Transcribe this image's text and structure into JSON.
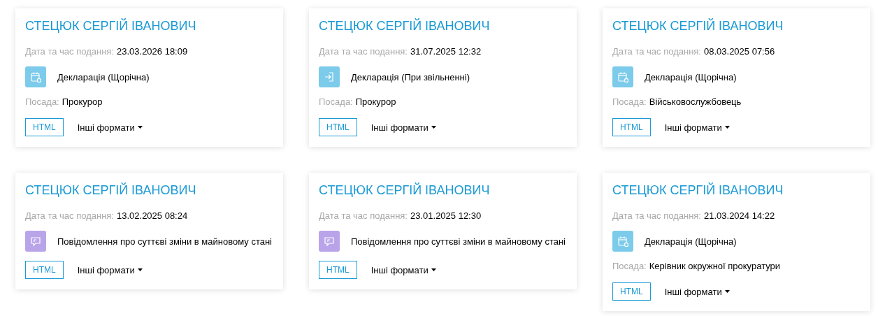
{
  "cards": [
    {
      "name": "СТЕЦЮК СЕРГІЙ ІВАНОВИЧ",
      "date_label": "Дата та час подання:",
      "date": "23.03.2026 18:09",
      "kind": "annual",
      "doc_type": "Декларація (Щорічна)",
      "position_label": "Посада:",
      "position": "Прокурор",
      "html_button": "HTML",
      "formats_button": "Інші формати"
    },
    {
      "name": "СТЕЦЮК СЕРГІЙ ІВАНОВИЧ",
      "date_label": "Дата та час подання:",
      "date": "31.07.2025 12:32",
      "kind": "dismissal",
      "doc_type": "Декларація (При звільненні)",
      "position_label": "Посада:",
      "position": "Прокурор",
      "html_button": "HTML",
      "formats_button": "Інші формати"
    },
    {
      "name": "СТЕЦЮК СЕРГІЙ ІВАНОВИЧ",
      "date_label": "Дата та час подання:",
      "date": "08.03.2025 07:56",
      "kind": "annual",
      "doc_type": "Декларація (Щорічна)",
      "position_label": "Посада:",
      "position": "Військовослужбовець",
      "html_button": "HTML",
      "formats_button": "Інші формати"
    },
    {
      "name": "СТЕЦЮК СЕРГІЙ ІВАНОВИЧ",
      "date_label": "Дата та час подання:",
      "date": "13.02.2025 08:24",
      "kind": "change",
      "doc_type": "Повідомлення про суттєві зміни в майновому стані",
      "html_button": "HTML",
      "formats_button": "Інші формати"
    },
    {
      "name": "СТЕЦЮК СЕРГІЙ ІВАНОВИЧ",
      "date_label": "Дата та час подання:",
      "date": "23.01.2025 12:30",
      "kind": "change",
      "doc_type": "Повідомлення про суттєві зміни в майновому стані",
      "html_button": "HTML",
      "formats_button": "Інші формати"
    },
    {
      "name": "СТЕЦЮК СЕРГІЙ ІВАНОВИЧ",
      "date_label": "Дата та час подання:",
      "date": "21.03.2024 14:22",
      "kind": "annual",
      "doc_type": "Декларація (Щорічна)",
      "position_label": "Посада:",
      "position": "Керівник окружної прокуратури",
      "html_button": "HTML",
      "formats_button": "Інші формати"
    }
  ]
}
